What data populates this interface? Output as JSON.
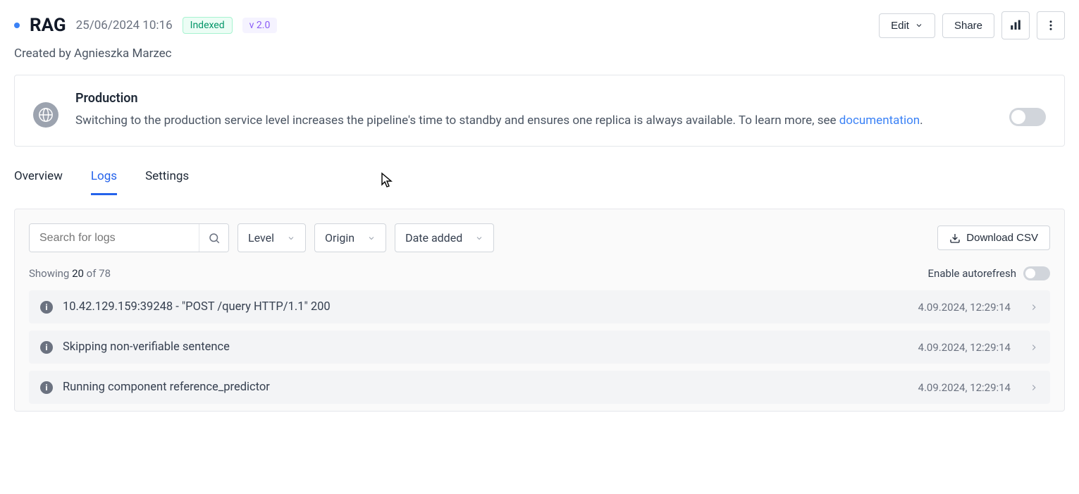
{
  "header": {
    "title": "RAG",
    "timestamp": "25/06/2024 10:16",
    "status_badge": "Indexed",
    "version_badge": "v 2.0",
    "edit_label": "Edit",
    "share_label": "Share"
  },
  "created_by": "Created by Agnieszka Marzec",
  "production_card": {
    "title": "Production",
    "text_pre": "Switching to the production service level increases the pipeline's time to standby and ensures one replica is always available. To learn more, see ",
    "link_text": "documentation",
    "text_post": "."
  },
  "tabs": [
    "Overview",
    "Logs",
    "Settings"
  ],
  "active_tab_index": 1,
  "logs_panel": {
    "search_placeholder": "Search for logs",
    "filters": {
      "level": "Level",
      "origin": "Origin",
      "date_added": "Date added"
    },
    "download_label": "Download CSV",
    "showing_prefix": "Showing ",
    "showing_count": "20",
    "showing_of": " of 78",
    "autorefresh_label": "Enable autorefresh",
    "rows": [
      {
        "message": "10.42.129.159:39248 - \"POST /query HTTP/1.1\" 200",
        "time": "4.09.2024, 12:29:14"
      },
      {
        "message": "Skipping non-verifiable sentence",
        "time": "4.09.2024, 12:29:14"
      },
      {
        "message": "Running component reference_predictor",
        "time": "4.09.2024, 12:29:14"
      }
    ]
  }
}
